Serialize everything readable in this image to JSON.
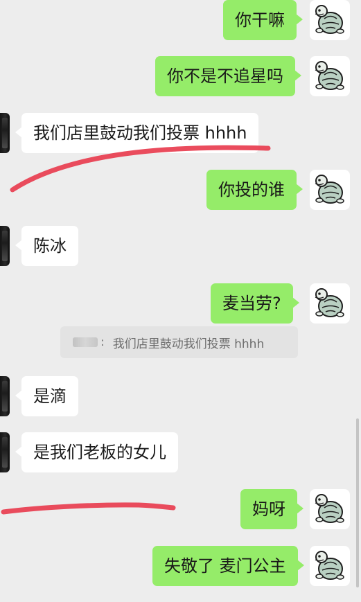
{
  "messages": [
    {
      "text": "你干嘛"
    },
    {
      "text": "你不是不追星吗"
    },
    {
      "text": "我们店里鼓动我们投票 hhhh"
    },
    {
      "text": "你投的谁"
    },
    {
      "text": "陈冰"
    },
    {
      "text": "麦当劳?"
    },
    {
      "text": "是滴"
    },
    {
      "text": "是我们老板的女儿"
    },
    {
      "text": "妈呀"
    },
    {
      "text": "失敬了 麦门公主"
    }
  ],
  "quote": {
    "separator": ":",
    "text": "我们店里鼓动我们投票 hhhh"
  },
  "colors": {
    "background": "#ededed",
    "my_bubble": "#95ec69",
    "their_bubble": "#ffffff",
    "annotation": "#e8394b"
  }
}
